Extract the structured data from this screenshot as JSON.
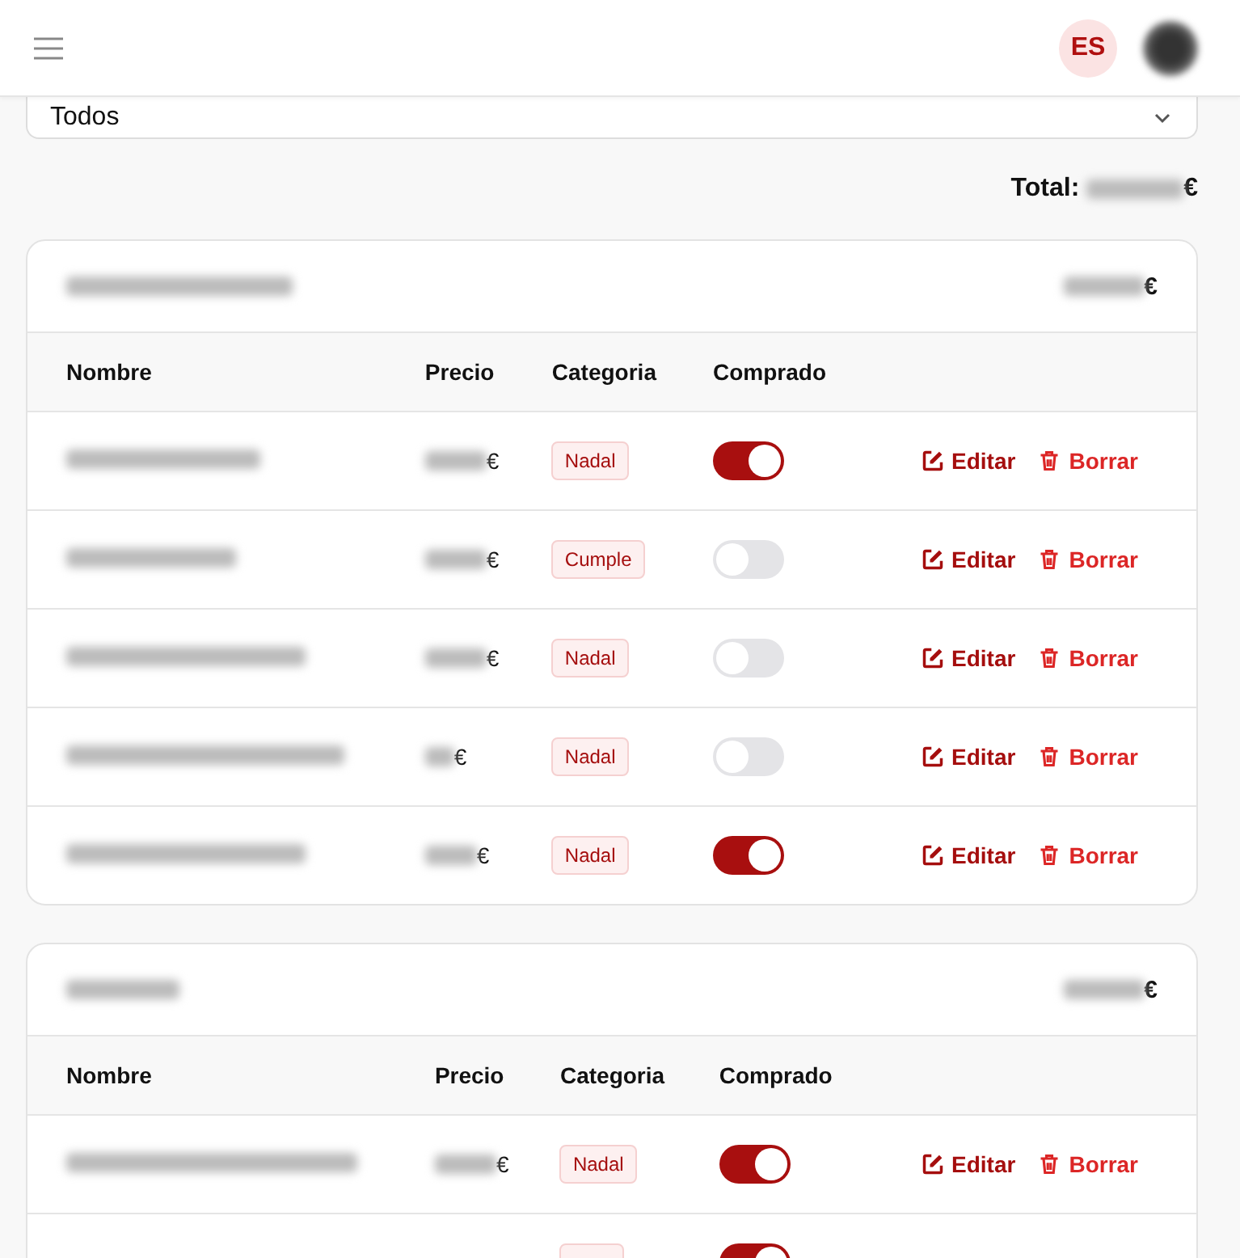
{
  "header": {
    "language": "ES"
  },
  "filter": {
    "value": "Todos"
  },
  "total": {
    "label": "Total:",
    "currency": "€"
  },
  "groups": [
    {
      "total_currency": "€",
      "columns": [
        "Nombre",
        "Precio",
        "Categoria",
        "Comprado"
      ],
      "items": [
        {
          "price_currency": "€",
          "category": "Nadal",
          "purchased": true,
          "actions": [
            "Editar",
            "Borrar"
          ]
        },
        {
          "price_currency": "€",
          "category": "Cumple",
          "purchased": false,
          "actions": [
            "Editar",
            "Borrar"
          ]
        },
        {
          "price_currency": "€",
          "category": "Nadal",
          "purchased": false,
          "actions": [
            "Editar",
            "Borrar"
          ]
        },
        {
          "price_currency": "€",
          "category": "Nadal",
          "purchased": false,
          "actions": [
            "Editar",
            "Borrar"
          ]
        },
        {
          "price_currency": "€",
          "category": "Nadal",
          "purchased": true,
          "actions": [
            "Editar",
            "Borrar"
          ]
        }
      ]
    },
    {
      "total_currency": "€",
      "columns": [
        "Nombre",
        "Precio",
        "Categoria",
        "Comprado"
      ],
      "items": [
        {
          "price_currency": "€",
          "category": "Nadal",
          "purchased": true,
          "actions": [
            "Editar",
            "Borrar"
          ]
        },
        {
          "purchased": true
        }
      ]
    }
  ]
}
